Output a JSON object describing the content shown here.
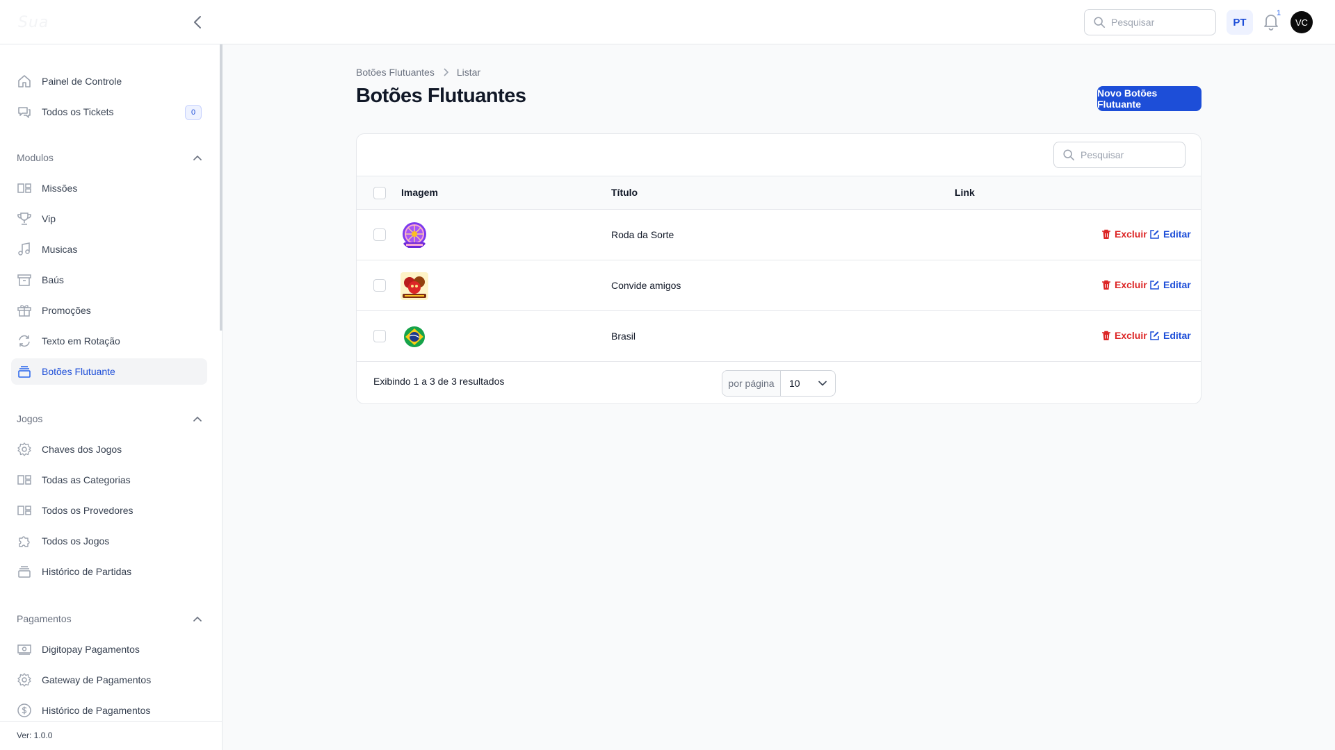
{
  "topbar": {
    "logo_text": "Sua",
    "search_placeholder": "Pesquisar",
    "language": "PT",
    "notification_count": "1",
    "user_initials": "VC"
  },
  "sidebar": {
    "top_items": [
      {
        "label": "Painel de Controle",
        "icon": "home-icon"
      },
      {
        "label": "Todos os Tickets",
        "icon": "chat-icon",
        "badge": "0"
      }
    ],
    "groups": [
      {
        "title": "Modulos",
        "items": [
          {
            "label": "Missões",
            "icon": "grid-icon"
          },
          {
            "label": "Vip",
            "icon": "trophy-icon"
          },
          {
            "label": "Musicas",
            "icon": "music-icon"
          },
          {
            "label": "Baús",
            "icon": "archive-icon"
          },
          {
            "label": "Promoções",
            "icon": "gift-icon"
          },
          {
            "label": "Texto em Rotação",
            "icon": "refresh-icon"
          },
          {
            "label": "Botões Flutuante",
            "icon": "stack-icon",
            "active": true
          }
        ]
      },
      {
        "title": "Jogos",
        "items": [
          {
            "label": "Chaves dos Jogos",
            "icon": "gear-icon"
          },
          {
            "label": "Todas as Categorias",
            "icon": "grid-icon"
          },
          {
            "label": "Todos os Provedores",
            "icon": "grid-icon"
          },
          {
            "label": "Todos os Jogos",
            "icon": "puzzle-icon"
          },
          {
            "label": "Histórico de Partidas",
            "icon": "stack-icon"
          }
        ]
      },
      {
        "title": "Pagamentos",
        "items": [
          {
            "label": "Digitopay Pagamentos",
            "icon": "cash-icon"
          },
          {
            "label": "Gateway de Pagamentos",
            "icon": "gear-icon"
          },
          {
            "label": "Histórico de Pagamentos",
            "icon": "dollar-icon"
          }
        ]
      }
    ],
    "version": "Ver: 1.0.0"
  },
  "main": {
    "breadcrumb": [
      "Botões Flutuantes",
      "Listar"
    ],
    "title": "Botões Flutuantes",
    "new_button": "Novo Botões Flutuante",
    "table": {
      "search_placeholder": "Pesquisar",
      "columns": [
        "Imagem",
        "Título",
        "Link"
      ],
      "rows": [
        {
          "title": "Roda da Sorte",
          "image": "wheel-image",
          "link": ""
        },
        {
          "title": "Convide amigos",
          "image": "friends-image",
          "link": ""
        },
        {
          "title": "Brasil",
          "image": "brazil-image",
          "link": ""
        }
      ],
      "delete_label": "Excluir",
      "edit_label": "Editar",
      "footer": "Exibindo 1 a 3 de 3 resultados",
      "per_page_label": "por página",
      "per_page_value": "10"
    }
  },
  "colors": {
    "primary": "#1d4ed8",
    "danger": "#dc2626",
    "muted": "#6b7280"
  }
}
